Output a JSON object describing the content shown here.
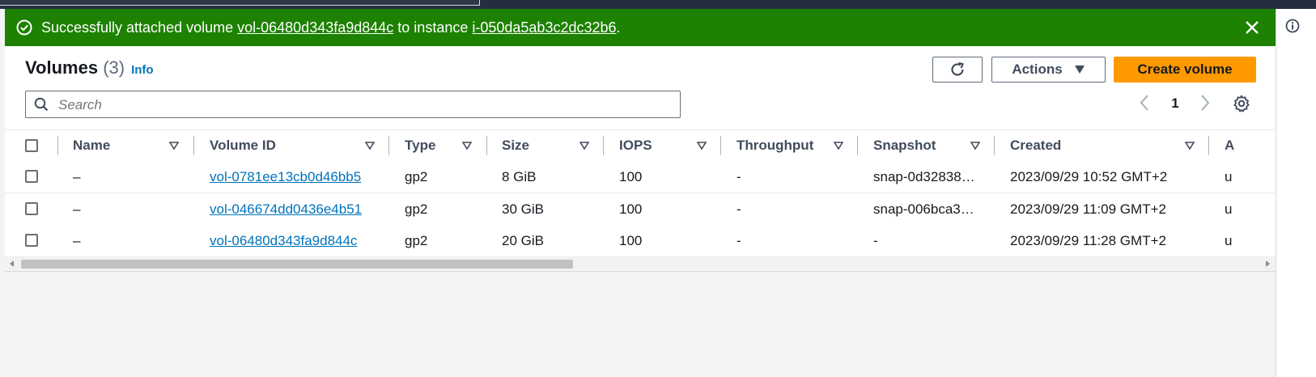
{
  "flash": {
    "text_prefix": "Successfully attached volume ",
    "volume_link": "vol-06480d343fa9d844c",
    "text_mid": " to instance ",
    "instance_link": "i-050da5ab3c2dc32b6",
    "text_suffix": ".",
    "status_color": "#1d8102"
  },
  "header": {
    "title": "Volumes",
    "count": "(3)",
    "info": "Info"
  },
  "toolbar": {
    "actions_label": "Actions",
    "create_label": "Create volume"
  },
  "search": {
    "placeholder": "Search"
  },
  "pagination": {
    "page": "1"
  },
  "table": {
    "columns": [
      "Name",
      "Volume ID",
      "Type",
      "Size",
      "IOPS",
      "Throughput",
      "Snapshot",
      "Created",
      "A"
    ],
    "rows": [
      {
        "name": "–",
        "volume_id": "vol-0781ee13cb0d46bb5",
        "type": "gp2",
        "size": "8 GiB",
        "iops": "100",
        "throughput": "-",
        "snapshot": "snap-0d32838…",
        "created": "2023/09/29 10:52 GMT+2",
        "extra": "u"
      },
      {
        "name": "–",
        "volume_id": "vol-046674dd0436e4b51",
        "type": "gp2",
        "size": "30 GiB",
        "iops": "100",
        "throughput": "-",
        "snapshot": "snap-006bca3…",
        "created": "2023/09/29 11:09 GMT+2",
        "extra": "u"
      },
      {
        "name": "–",
        "volume_id": "vol-06480d343fa9d844c",
        "type": "gp2",
        "size": "20 GiB",
        "iops": "100",
        "throughput": "-",
        "snapshot": "-",
        "created": "2023/09/29 11:28 GMT+2",
        "extra": "u"
      }
    ]
  },
  "colors": {
    "primary": "#ff9900",
    "link": "#0073bb",
    "success": "#1d8102"
  }
}
